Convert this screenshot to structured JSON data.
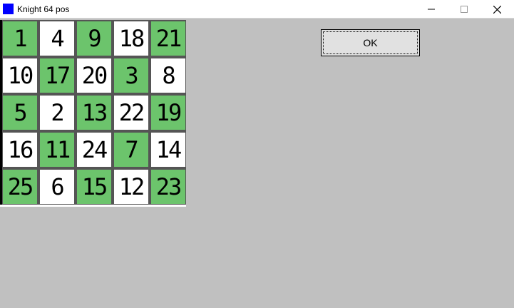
{
  "window": {
    "title": "Knight 64 pos",
    "icon": "app-icon",
    "controls": [
      "minimize-icon",
      "maximize-icon",
      "close-icon"
    ],
    "accent": "#0000ff"
  },
  "board": {
    "colors": {
      "green": "#6cc46c",
      "white": "#ffffff",
      "grid": "#555555"
    },
    "rows": [
      [
        "1",
        "4",
        "9",
        "18",
        "21"
      ],
      [
        "10",
        "17",
        "20",
        "3",
        "8"
      ],
      [
        "5",
        "2",
        "13",
        "22",
        "19"
      ],
      [
        "16",
        "11",
        "24",
        "7",
        "14"
      ],
      [
        "25",
        "6",
        "15",
        "12",
        "23"
      ]
    ],
    "shade": [
      [
        "g",
        "w",
        "g",
        "w",
        "g"
      ],
      [
        "w",
        "g",
        "w",
        "g",
        "w"
      ],
      [
        "g",
        "w",
        "g",
        "w",
        "g"
      ],
      [
        "w",
        "g",
        "w",
        "g",
        "w"
      ],
      [
        "g",
        "w",
        "g",
        "w",
        "g"
      ]
    ]
  },
  "ok_button": {
    "label": "OK"
  }
}
